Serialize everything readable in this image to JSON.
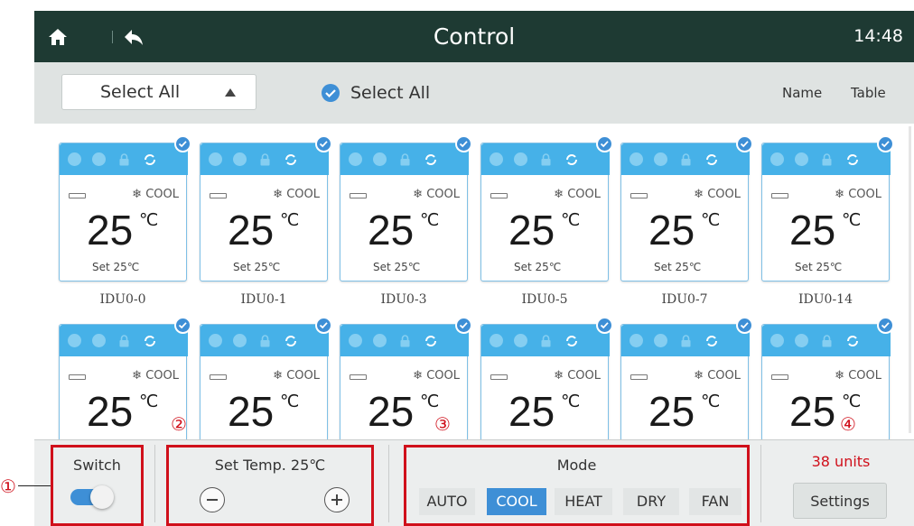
{
  "header": {
    "title": "Control",
    "time": "14:48"
  },
  "filter": {
    "dropdown_label": "Select All",
    "checkbox_label": "Select All",
    "name_label": "Name",
    "table_label": "Table"
  },
  "units": [
    {
      "name": "IDU0-0",
      "temp": "25",
      "unit": "℃",
      "mode": "COOL",
      "set": "Set  25℃"
    },
    {
      "name": "IDU0-1",
      "temp": "25",
      "unit": "℃",
      "mode": "COOL",
      "set": "Set  25℃"
    },
    {
      "name": "IDU0-3",
      "temp": "25",
      "unit": "℃",
      "mode": "COOL",
      "set": "Set  25℃"
    },
    {
      "name": "IDU0-5",
      "temp": "25",
      "unit": "℃",
      "mode": "COOL",
      "set": "Set  25℃"
    },
    {
      "name": "IDU0-7",
      "temp": "25",
      "unit": "℃",
      "mode": "COOL",
      "set": "Set  25℃"
    },
    {
      "name": "IDU0-14",
      "temp": "25",
      "unit": "℃",
      "mode": "COOL",
      "set": "Set  25℃"
    },
    {
      "name": "",
      "temp": "25",
      "unit": "℃",
      "mode": "COOL",
      "set": ""
    },
    {
      "name": "",
      "temp": "25",
      "unit": "℃",
      "mode": "COOL",
      "set": ""
    },
    {
      "name": "",
      "temp": "25",
      "unit": "℃",
      "mode": "COOL",
      "set": ""
    },
    {
      "name": "",
      "temp": "25",
      "unit": "℃",
      "mode": "COOL",
      "set": ""
    },
    {
      "name": "",
      "temp": "25",
      "unit": "℃",
      "mode": "COOL",
      "set": ""
    },
    {
      "name": "",
      "temp": "25",
      "unit": "℃",
      "mode": "COOL",
      "set": ""
    }
  ],
  "bottom": {
    "switch_label": "Switch",
    "switch_on": true,
    "set_temp_label": "Set Temp. 25℃",
    "mode_label": "Mode",
    "modes": [
      "AUTO",
      "COOL",
      "HEAT",
      "DRY",
      "FAN"
    ],
    "active_mode": "COOL",
    "units_count": "38 units",
    "settings_label": "Settings"
  },
  "callouts": [
    "①",
    "②",
    "③",
    "④"
  ],
  "colors": {
    "topbar": "#1e3a33",
    "card_header": "#46b1e8",
    "accent": "#3e8fd6",
    "annotation": "#d0101b"
  },
  "icons": {
    "home": "home-icon",
    "back": "back-icon",
    "check": "check-icon",
    "snowflake": "snowflake-icon"
  }
}
